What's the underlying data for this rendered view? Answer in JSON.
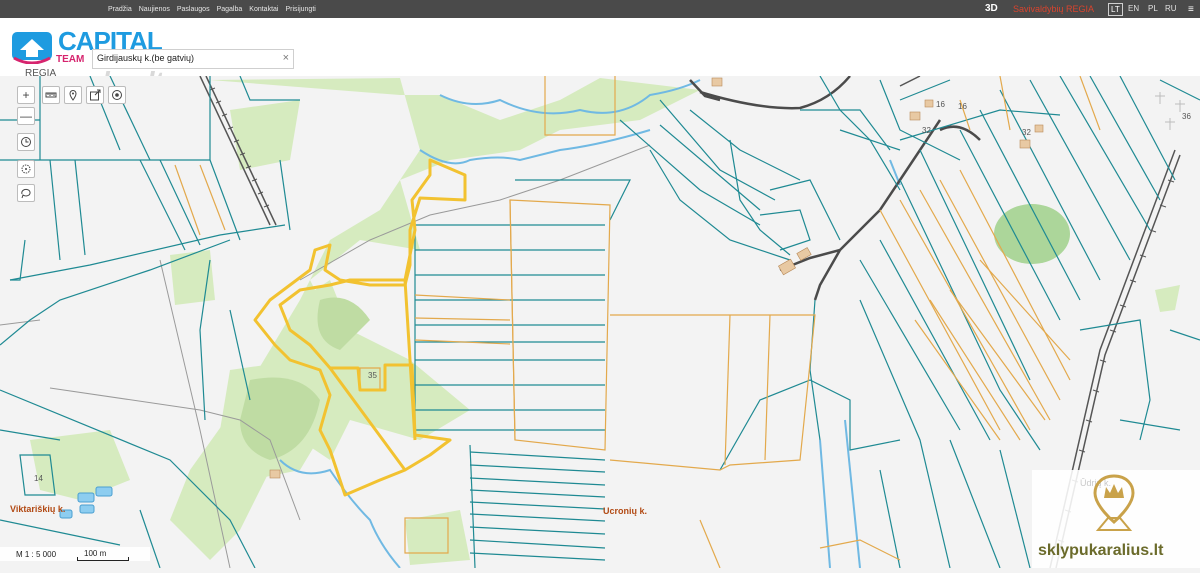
{
  "nav": {
    "items": [
      "Pradžia",
      "Naujienos",
      "Paslaugos",
      "Pagalba",
      "Kontaktai",
      "Prisijungti"
    ],
    "btn_3d": "3D",
    "regia_label": "Savivaldybių REGIA",
    "languages": [
      "LT",
      "EN",
      "PL",
      "RU"
    ],
    "active_language": "LT"
  },
  "logo": {
    "word": "CAPITAL",
    "team": "TEAM",
    "sub": "REGIA"
  },
  "watermark_top": "aruodas.lt",
  "search": {
    "value": "Girdijauskų k.(be gatvių)",
    "clear": "×"
  },
  "toolbar": {
    "zoom_in": "+",
    "zoom_out": "—"
  },
  "map": {
    "place_labels": [
      "Viktariškių k.",
      "Ucronių k."
    ],
    "plot_numbers": [
      "35",
      "14",
      "16",
      "16",
      "32",
      "32",
      "36"
    ]
  },
  "scale": {
    "ratio": "M 1 : 5 000",
    "distance": "100 m"
  },
  "brand": {
    "text": "sklypukaralius.lt",
    "faint": "Ūdrių k."
  },
  "colors": {
    "parcel_teal": "#1f8a93",
    "parcel_orange": "#e3a94c",
    "highlight": "#f2c230",
    "forest": "#d6ebbf",
    "river": "#70b9e3",
    "road": "#555555"
  }
}
